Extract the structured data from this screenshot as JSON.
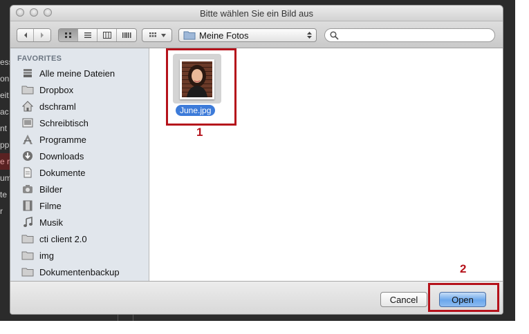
{
  "window": {
    "title": "Bitte wählen Sie ein Bild aus"
  },
  "toolbar": {
    "location": "Meine Fotos",
    "search_value": "",
    "search_placeholder": ""
  },
  "background_app": {
    "side_fragments": [
      "ess",
      "on",
      "eit",
      "ac",
      "nt",
      "pp",
      "e r",
      "um",
      "te",
      "r"
    ]
  },
  "sidebar": {
    "heading": "FAVORITES",
    "items": [
      {
        "label": "Alle meine Dateien",
        "icon": "all-files-icon"
      },
      {
        "label": "Dropbox",
        "icon": "folder-icon"
      },
      {
        "label": "dschraml",
        "icon": "home-icon"
      },
      {
        "label": "Schreibtisch",
        "icon": "desktop-icon"
      },
      {
        "label": "Programme",
        "icon": "applications-icon"
      },
      {
        "label": "Downloads",
        "icon": "downloads-icon"
      },
      {
        "label": "Dokumente",
        "icon": "documents-icon"
      },
      {
        "label": "Bilder",
        "icon": "camera-icon"
      },
      {
        "label": "Filme",
        "icon": "film-icon"
      },
      {
        "label": "Musik",
        "icon": "music-icon"
      },
      {
        "label": "cti client 2.0",
        "icon": "folder-icon"
      },
      {
        "label": "img",
        "icon": "folder-icon"
      },
      {
        "label": "Dokumentenbackup",
        "icon": "folder-icon"
      }
    ]
  },
  "files": [
    {
      "name": "June.jpg",
      "selected": true
    }
  ],
  "footer": {
    "cancel_label": "Cancel",
    "open_label": "Open"
  },
  "annotations": {
    "step1": "1",
    "step2": "2",
    "color": "#b5121b"
  },
  "colors": {
    "selection": "#3d7bd9",
    "sidebar_bg": "#e1e6ec",
    "primary_button": "#6aa7ec"
  }
}
